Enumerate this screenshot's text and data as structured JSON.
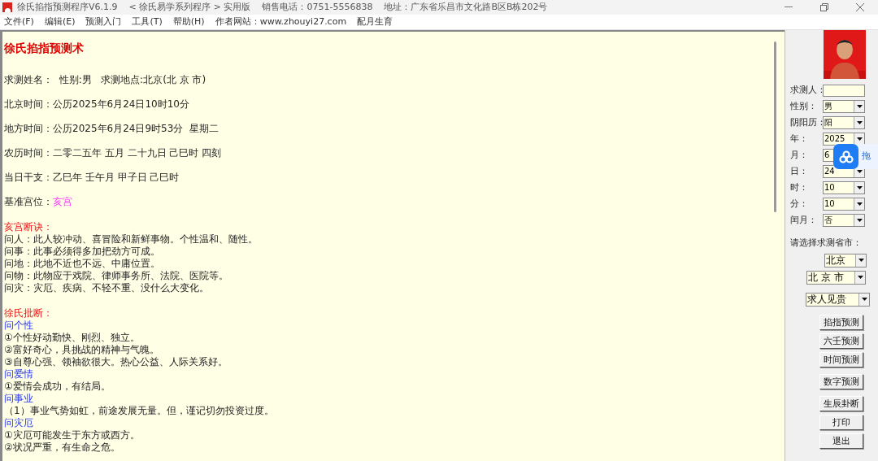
{
  "window": {
    "title_parts": [
      "徐氏掐指预测程序V6.1.9",
      "< 徐氏易学系列程序 > 实用版",
      "销售电话：0751-5556838",
      "地址：广东省乐昌市文化路B区B栋202号"
    ]
  },
  "menu": [
    "文件(F)",
    "编辑(E)",
    "预测入门",
    "工具(T)",
    "帮助(H)",
    "作者网站：www.zhouyi27.com",
    "配月生育"
  ],
  "report": {
    "title": "徐氏掐指预测术",
    "info_lines": [
      {
        "kind": "plain",
        "text": "求测姓名：  性别:男   求测地点:北京(北 京 市)"
      },
      {
        "kind": "plain",
        "text": "北京时间：公历2025年6月24日10时10分"
      },
      {
        "kind": "plain",
        "text": "地方时间：公历2025年6月24日9时53分  星期二"
      },
      {
        "kind": "plain",
        "text": "农历时间：二零二五年 五月 二十九日 己巳时 四刻"
      },
      {
        "kind": "plain",
        "text": "当日干支：乙巳年 壬午月 甲子日 己巳时"
      },
      {
        "kind": "highlight",
        "label": "基准宫位：",
        "value": "亥宫"
      }
    ],
    "sections": [
      {
        "heading": "亥宫断诀：",
        "lines": [
          {
            "kind": "line",
            "text": "问人：此人较冲动、喜冒险和新鲜事物。个性温和、随性。"
          },
          {
            "kind": "line",
            "text": "问事：此事必须得多加把劲方可成。"
          },
          {
            "kind": "line",
            "text": "问地：此地不近也不远、中庸位置。"
          },
          {
            "kind": "line",
            "text": "问物：此物应于戏院、律师事务所、法院、医院等。"
          },
          {
            "kind": "line",
            "text": "问灾：灾厄、疾病、不轻不重、没什么大变化。"
          }
        ]
      },
      {
        "heading": "徐氏批断：",
        "lines": [
          {
            "kind": "topic",
            "text": "问个性"
          },
          {
            "kind": "line",
            "text": "①个性好动勤快、刚烈、独立。"
          },
          {
            "kind": "line",
            "text": "②富好奇心，具挑战的精神与气魄。"
          },
          {
            "kind": "line",
            "text": "③自尊心强、领袖欲很大。热心公益、人际关系好。"
          },
          {
            "kind": "topic",
            "text": "问爱情"
          },
          {
            "kind": "line",
            "text": "①爱情会成功，有结局。"
          },
          {
            "kind": "topic",
            "text": "问事业"
          },
          {
            "kind": "line",
            "text": "（1）事业气势如虹，前途发展无量。但，谨记切勿投资过度。"
          },
          {
            "kind": "topic",
            "text": "问灾厄"
          },
          {
            "kind": "line",
            "text": "①灾厄可能发生于东方或西方。"
          },
          {
            "kind": "line",
            "text": "②状况严重，有生命之危。"
          }
        ]
      }
    ]
  },
  "side_panel": {
    "fields": [
      {
        "kind": "input",
        "label": "求测人："
      },
      {
        "kind": "select",
        "label": "性别：",
        "value": "男"
      },
      {
        "kind": "select",
        "label": "阴阳历：",
        "value": "阳"
      },
      {
        "kind": "select",
        "label": "年：",
        "value": "2025"
      },
      {
        "kind": "select",
        "label": "月：",
        "value": "6"
      },
      {
        "kind": "select",
        "label": "日：",
        "value": "24"
      },
      {
        "kind": "select",
        "label": "时：",
        "value": "10"
      },
      {
        "kind": "select",
        "label": "分：",
        "value": "10"
      },
      {
        "kind": "select",
        "label": "闰月：",
        "value": "否"
      }
    ],
    "region_label": "请选择求测省市：",
    "province": "北京",
    "city": "北 京 市",
    "category": "求人见贵",
    "buttons": [
      "掐指预测",
      "六壬预测",
      "时间预测",
      "数字预测",
      "生辰卦断",
      "打印",
      "退出"
    ]
  },
  "floating_badge": {
    "text": "拖"
  }
}
